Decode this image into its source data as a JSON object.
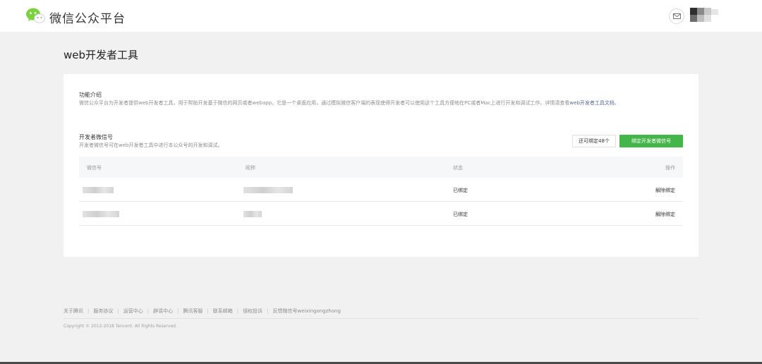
{
  "header": {
    "brand": "微信公众平台",
    "logo_icon": "wechat-logo-icon",
    "mail_icon": "mail-icon"
  },
  "page": {
    "title": "web开发者工具"
  },
  "intro": {
    "title": "功能介绍",
    "desc_text": "微信公众平台为开发者提供web开发者工具，用于帮助开发基于微信的网页或者webapp。它是一个桌面应用，通过模拟微信客户端的表现使得开发者可以使用这个工具方便地在PC或者Mac上进行开发和调试工作。详情请查看",
    "doc_link": "web开发者工具文档",
    "desc_end": "。"
  },
  "developers": {
    "title": "开发者微信号",
    "desc": "开发者微信号可在web开发者工具中进行本公众号的开发和调试。",
    "remaining": "还可绑定48个",
    "bind_button": "绑定开发者微信号"
  },
  "table": {
    "headers": [
      "微信号",
      "昵称",
      "状态",
      "操作"
    ],
    "rows": [
      {
        "status": "已绑定",
        "action": "解除绑定"
      },
      {
        "status": "已绑定",
        "action": "解除绑定"
      }
    ]
  },
  "footer": {
    "links": [
      "关于腾讯",
      "服务协议",
      "运营中心",
      "辟谣中心",
      "腾讯客服",
      "联系邮箱",
      "侵权投诉",
      "反馈微信号weixingongzhong"
    ],
    "copyright": "Copyright © 2012-2018 Tencent. All Rights Reserved."
  },
  "colors": {
    "accent_green": "#44b549",
    "link_blue": "#576b95",
    "page_bg": "#f1f1f1"
  }
}
